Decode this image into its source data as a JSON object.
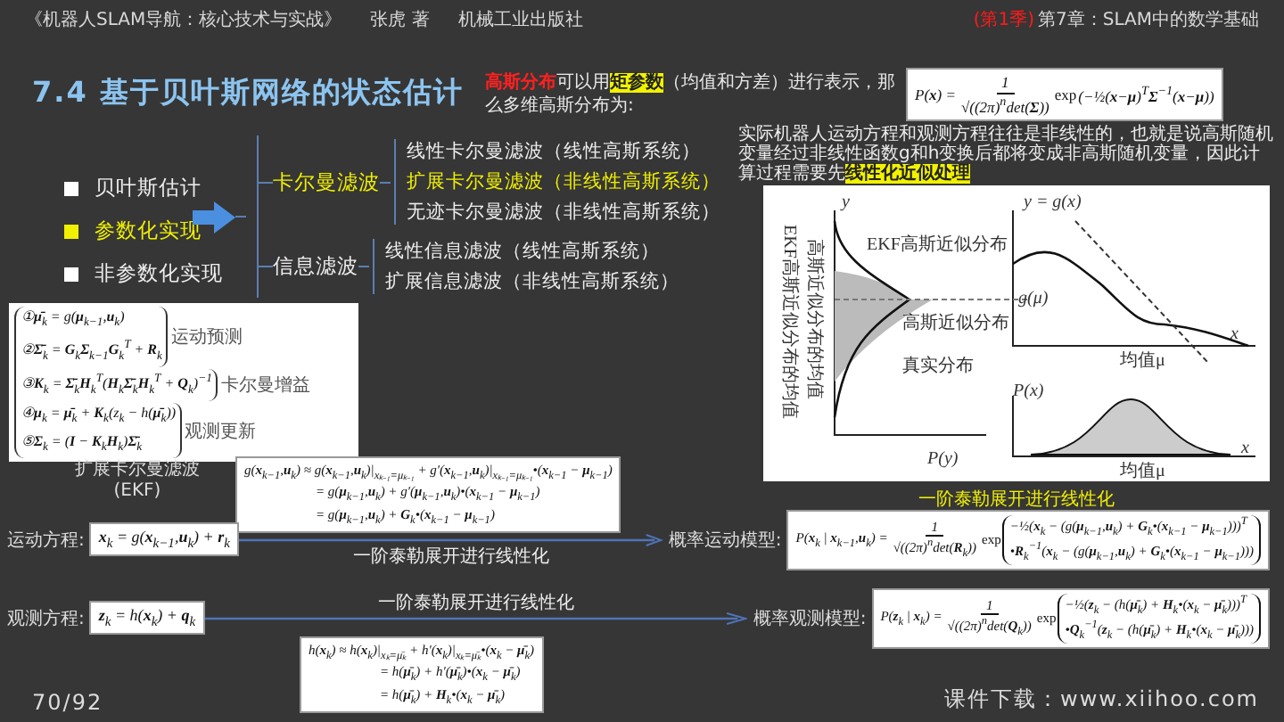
{
  "header": {
    "book": "《机器人SLAM导航：核心技术与实战》",
    "author": "张虎 著",
    "publisher": "机械工业出版社",
    "season": "(第1季)",
    "chapter": "第7章：SLAM中的数学基础"
  },
  "title": "7.4 基于贝叶斯网络的状态估计",
  "intro": [
    {
      "kind": "red",
      "text": "高斯分布"
    },
    {
      "kind": "plain",
      "text": "可以用"
    },
    {
      "kind": "highlight",
      "text": "矩参数"
    },
    {
      "kind": "plain",
      "text": "（均值和方差）进行表示，那么多维高斯分布为:"
    }
  ],
  "gaussian": {
    "lhs": "P(**x**) =",
    "num": "1",
    "den": "√((2π)$^{n}$det(**Σ**))",
    "func": "exp",
    "tail": [
      "(−½(**x**−**μ**)$^{T}$**Σ**$^{−1}$(**x**−**μ**))"
    ]
  },
  "note": [
    {
      "kind": "plain",
      "text": "实际机器人运动方程和观测方程往往是非线性的，也就是说高斯随机变量经过非线性函数g和h变换后都将变成非高斯随机变量，因此计算过程需要先"
    },
    {
      "kind": "highlight",
      "text": "线性化近似处理"
    }
  ],
  "figure": {
    "labels": [
      "y",
      "y = g(x)",
      "EKF高斯近似分布",
      "高斯近似分布",
      "真实分布",
      "g(μ)",
      "P(y)",
      "x",
      "均值μ",
      "P(x)",
      "x",
      "均值μ",
      "EKF高斯近似分布的均值",
      "高斯近似分布的均值"
    ],
    "caption": "一阶泰勒展开进行线性化"
  },
  "bullets": [
    {
      "label": "贝叶斯估计",
      "selected": false
    },
    {
      "label": "参数化实现",
      "selected": true
    },
    {
      "label": "非参数化实现",
      "selected": false
    }
  ],
  "tree": [
    {
      "label": "卡尔曼滤波",
      "selected": true,
      "children": [
        {
          "label": "线性卡尔曼滤波（线性高斯系统）",
          "selected": false
        },
        {
          "label": "扩展卡尔曼滤波（非线性高斯系统）",
          "selected": true
        },
        {
          "label": "无迹卡尔曼滤波（非线性高斯系统）",
          "selected": false
        }
      ]
    },
    {
      "label": "信息滤波",
      "selected": false,
      "children": [
        {
          "label": "线性信息滤波（线性高斯系统）",
          "selected": false
        },
        {
          "label": "扩展信息滤波（非线性高斯系统）",
          "selected": false
        }
      ]
    }
  ],
  "ekf": {
    "groups": [
      {
        "lines": [
          "①**μ̄**$_{k}$ = g(**μ**$_{k−1}$,**u**$_{k}$)",
          "②**Σ̄**$_{k}$ = **G**$_{k}$**Σ**$_{k−1}$**G**$_{k}$$^{T}$ + **R**$_{k}$"
        ],
        "note": "运动预测"
      },
      {
        "lines": [
          "③**K**$_{k}$ = **Σ̄**$_{k}$**H**$_{k}$$^{T}$(**H**$_{k}$**Σ̄**$_{k}$**H**$_{k}$$^{T}$ + **Q**$_{k}$)$^{−1}$"
        ],
        "note": "卡尔曼增益"
      },
      {
        "lines": [
          "④**μ**$_{k}$ = **μ̄**$_{k}$ + **K**$_{k}$(z$_{k}$ − h(**μ̄**$_{k}$))",
          "⑤**Σ**$_{k}$ = (**I** − **K**$_{k}$**H**$_{k}$)**Σ̄**$_{k}$"
        ],
        "note": "观测更新"
      }
    ],
    "caption": [
      "扩展卡尔曼滤波",
      "(EKF)"
    ]
  },
  "motion": {
    "label": "运动方程:",
    "equation": "**x**$_{k}$ = g(**x**$_{k−1}$,**u**$_{k}$) + **r**$_{k}$",
    "arrow_caption": "一阶泰勒展开进行线性化",
    "model_label": "概率运动模型:",
    "taylor": [
      "g(**x**$_{k−1}$,**u**$_{k}$) ≈ g(**x**$_{k−1}$,**u**$_{k}$)|$_{xₖ₋₁=μₖ₋₁}$ + g′(**x**$_{k−1}$,**u**$_{k}$)|$_{xₖ₋₁=μₖ₋₁}$•(**x**$_{k−1}$ − **μ**$_{k−1}$)",
      "= g(**μ**$_{k−1}$,**u**$_{k}$) + g′(**μ**$_{k−1}$,**u**$_{k}$)•(**x**$_{k−1}$ − **μ**$_{k−1}$)",
      "= g(**μ**$_{k−1}$,**u**$_{k}$) + **G**$_{k}$•(**x**$_{k−1}$ − **μ**$_{k−1}$)"
    ],
    "model": {
      "lhs": "P(**x**$_{k}$ | **x**$_{k−1}$,**u**$_{k}$) =",
      "num": "1",
      "den": "√((2π)$^{n}$det(**R**$_{k}$))",
      "func": "exp",
      "tail": [
        "−½(**x**$_{k}$ − (g(**μ**$_{k−1}$,**u**$_{k}$) + **G**$_{k}$•(**x**$_{k−1}$ − **μ**$_{k−1}$)))$^{T}$",
        "•**R**$_{k}$$^{−1}$(**x**$_{k}$ − (g(**μ**$_{k−1}$,**u**$_{k}$) + **G**$_{k}$•(**x**$_{k−1}$ − **μ**$_{k−1}$)))"
      ]
    }
  },
  "observation": {
    "label": "观测方程:",
    "equation": "**z**$_{k}$ = h(**x**$_{k}$) + **q**$_{k}$",
    "arrow_caption": "一阶泰勒展开进行线性化",
    "model_label": "概率观测模型:",
    "taylor": [
      "h(**x**$_{k}$) ≈ h(**x**$_{k}$)|$_{xₖ=μ̄ₖ}$ + h′(**x**$_{k}$)|$_{xₖ=μ̄ₖ}$•(**x**$_{k}$ − **μ̄**$_{k}$)",
      "= h(**μ̄**$_{k}$) + h′(**μ̄**$_{k}$)•(**x**$_{k}$ − **μ̄**$_{k}$)",
      "= h(**μ̄**$_{k}$) + **H**$_{k}$•(**x**$_{k}$ − **μ̄**$_{k}$)"
    ],
    "model": {
      "lhs": "P(**z**$_{k}$ | **x**$_{k}$) =",
      "num": "1",
      "den": "√((2π)$^{n}$det(**Q**$_{k}$))",
      "func": "exp",
      "tail": [
        "−½(**z**$_{k}$ − (h(**μ̄**$_{k}$) + **H**$_{k}$•(**x**$_{k}$ − **μ̄**$_{k}$)))$^{T}$",
        "•**Q**$_{k}$$^{−1}$(**z**$_{k}$ − (h(**μ̄**$_{k}$) + **H**$_{k}$•(**x**$_{k}$ − **μ̄**$_{k}$)))"
      ]
    }
  },
  "footer": {
    "page": "70/92",
    "download": "课件下载：www.xiihoo.com"
  }
}
